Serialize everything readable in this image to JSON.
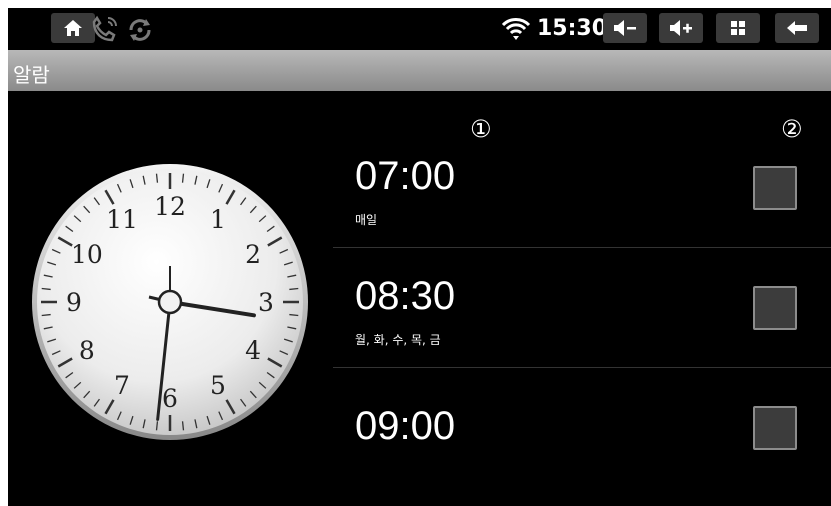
{
  "statusbar": {
    "time": "15:30",
    "icons": [
      "home-icon",
      "call-volume-icon",
      "rotate-icon",
      "wifi-icon",
      "volume-down-icon",
      "volume-up-icon",
      "app-grid-icon",
      "back-icon"
    ]
  },
  "titlebar": {
    "title": "알람"
  },
  "clock": {
    "numbers": [
      "12",
      "1",
      "2",
      "3",
      "4",
      "5",
      "6",
      "7",
      "8",
      "9",
      "10",
      "11"
    ],
    "hour_hand": 3.3,
    "minute_hand": 31
  },
  "markers": {
    "one": "①",
    "two": "②"
  },
  "alarms": [
    {
      "time": "07:00",
      "days": "매일",
      "enabled": false
    },
    {
      "time": "08:30",
      "days": "월, 화, 수, 목, 금",
      "enabled": false
    },
    {
      "time": "09:00",
      "days": "",
      "enabled": false
    }
  ],
  "colors": {
    "background": "#000000",
    "titlebar": "#a0a0a0",
    "checkbox": "#3c3c3c"
  }
}
